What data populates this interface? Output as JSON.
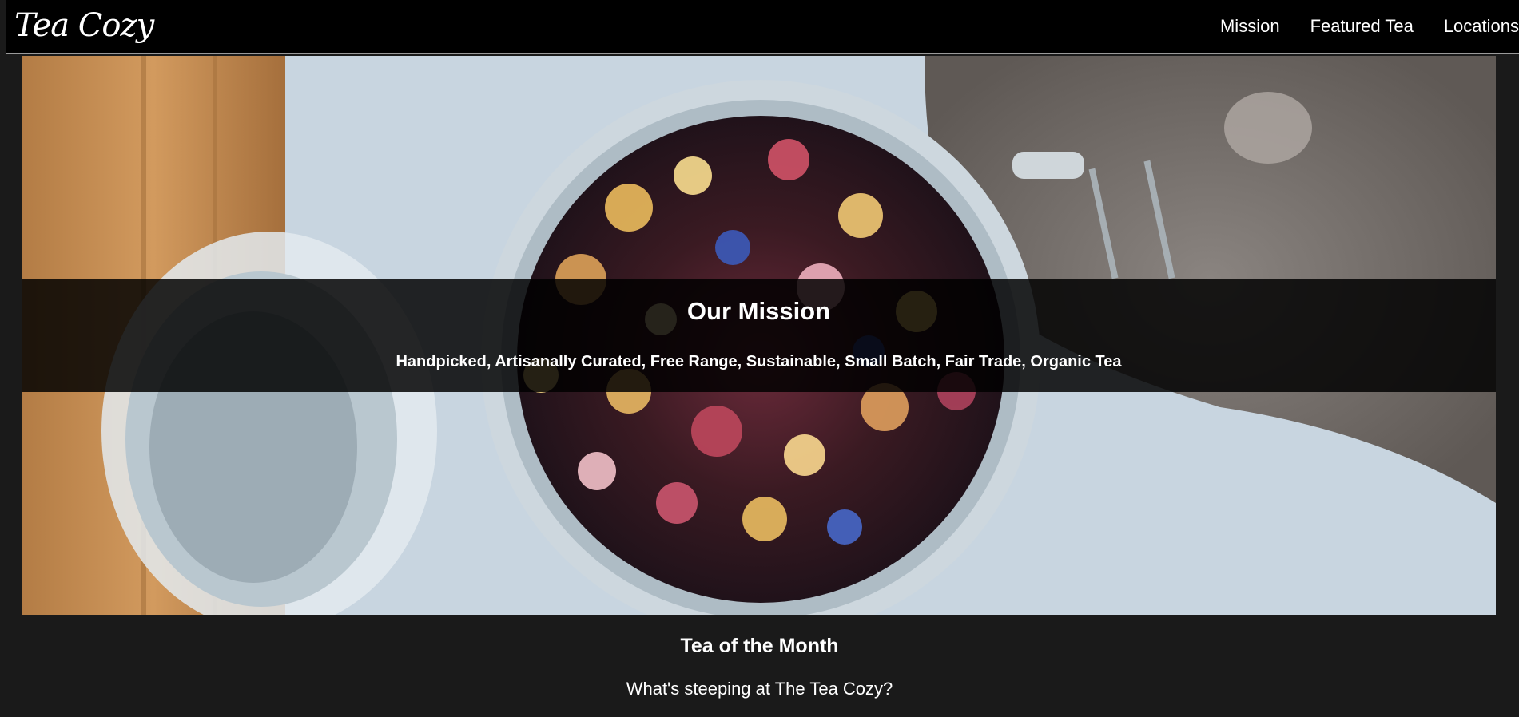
{
  "header": {
    "logo": "Tea Cozy",
    "nav": [
      "Mission",
      "Featured Tea",
      "Locations"
    ]
  },
  "hero": {
    "image": "jar-of-loose-leaf-tea-photo",
    "mission_title": "Our Mission",
    "mission_text": "Handpicked, Artisanally Curated, Free Range, Sustainable, Small Batch, Fair Trade, Organic Tea"
  },
  "tea_of_month": {
    "title": "Tea of the Month",
    "subtitle": "What's steeping at The Tea Cozy?"
  },
  "colors": {
    "page_bg": "#1a1a1a",
    "header_bg": "#000000",
    "text": "#ffffff"
  }
}
